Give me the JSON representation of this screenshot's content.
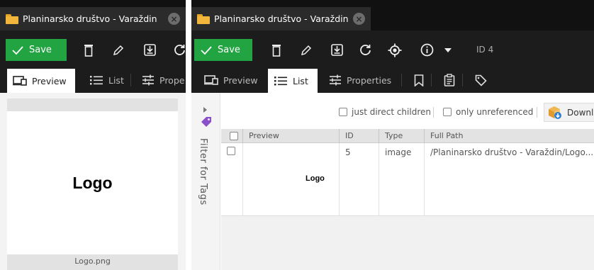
{
  "left": {
    "title": "Planinarsko društvo - Varaždin",
    "toolbar": {
      "save_label": "Save"
    },
    "tabs": [
      {
        "label": "Preview",
        "icon": "preview-icon",
        "active": true
      },
      {
        "label": "List",
        "icon": "list-icon",
        "active": false
      },
      {
        "label": "Prope",
        "icon": "properties-icon",
        "active": false
      }
    ],
    "preview": {
      "logo_text": "Logo",
      "caption": "Logo.png"
    }
  },
  "right": {
    "title": "Planinarsko društvo - Varaždin",
    "toolbar": {
      "save_label": "Save",
      "id_label": "ID 4"
    },
    "tabs": [
      {
        "label": "Preview",
        "icon": "preview-icon",
        "active": false
      },
      {
        "label": "List",
        "icon": "list-icon",
        "active": true
      },
      {
        "label": "Properties",
        "icon": "properties-icon",
        "active": false
      },
      {
        "label": "",
        "icon": "bookmark-icon",
        "active": false
      },
      {
        "label": "",
        "icon": "clipboard-icon",
        "active": false
      },
      {
        "label": "",
        "icon": "tag-icon",
        "active": false
      }
    ],
    "filter_label": "Filter for Tags",
    "options": {
      "direct_children": "just direct children",
      "unreferenced": "only unreferenced",
      "download": "Downlo"
    },
    "grid": {
      "columns": [
        "Preview",
        "ID",
        "Type",
        "Full Path"
      ],
      "rows": [
        {
          "id": "5",
          "type": "image",
          "path": "/Planinarsko društvo - Varaždin/Logo....",
          "preview_text": "Logo"
        }
      ]
    }
  },
  "colors": {
    "save_green": "#23a443",
    "folder_yellow": "#f2b63c",
    "tag_purple": "#8a4fc9",
    "dark_bg": "#1c1c1c"
  }
}
